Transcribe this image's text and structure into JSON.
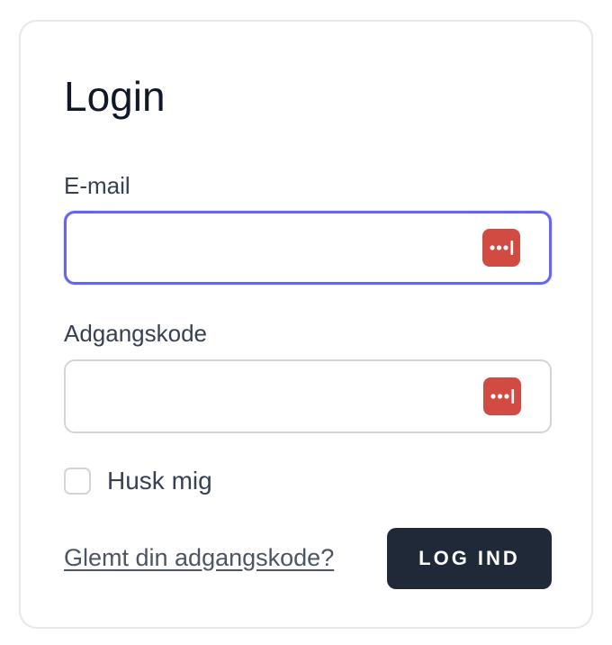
{
  "card": {
    "title": "Login"
  },
  "email": {
    "label": "E-mail",
    "value": "",
    "placeholder": ""
  },
  "password": {
    "label": "Adgangskode",
    "value": "",
    "placeholder": ""
  },
  "remember": {
    "label": "Husk mig",
    "checked": false
  },
  "actions": {
    "forgot_label": "Glemt din adgangskode?",
    "submit_label": "LOG IND"
  },
  "icons": {
    "password_manager": "password-manager-icon"
  },
  "colors": {
    "focus_border": "#6366f1",
    "button_bg": "#1f2937",
    "password_manager_icon": "#d14b42"
  }
}
